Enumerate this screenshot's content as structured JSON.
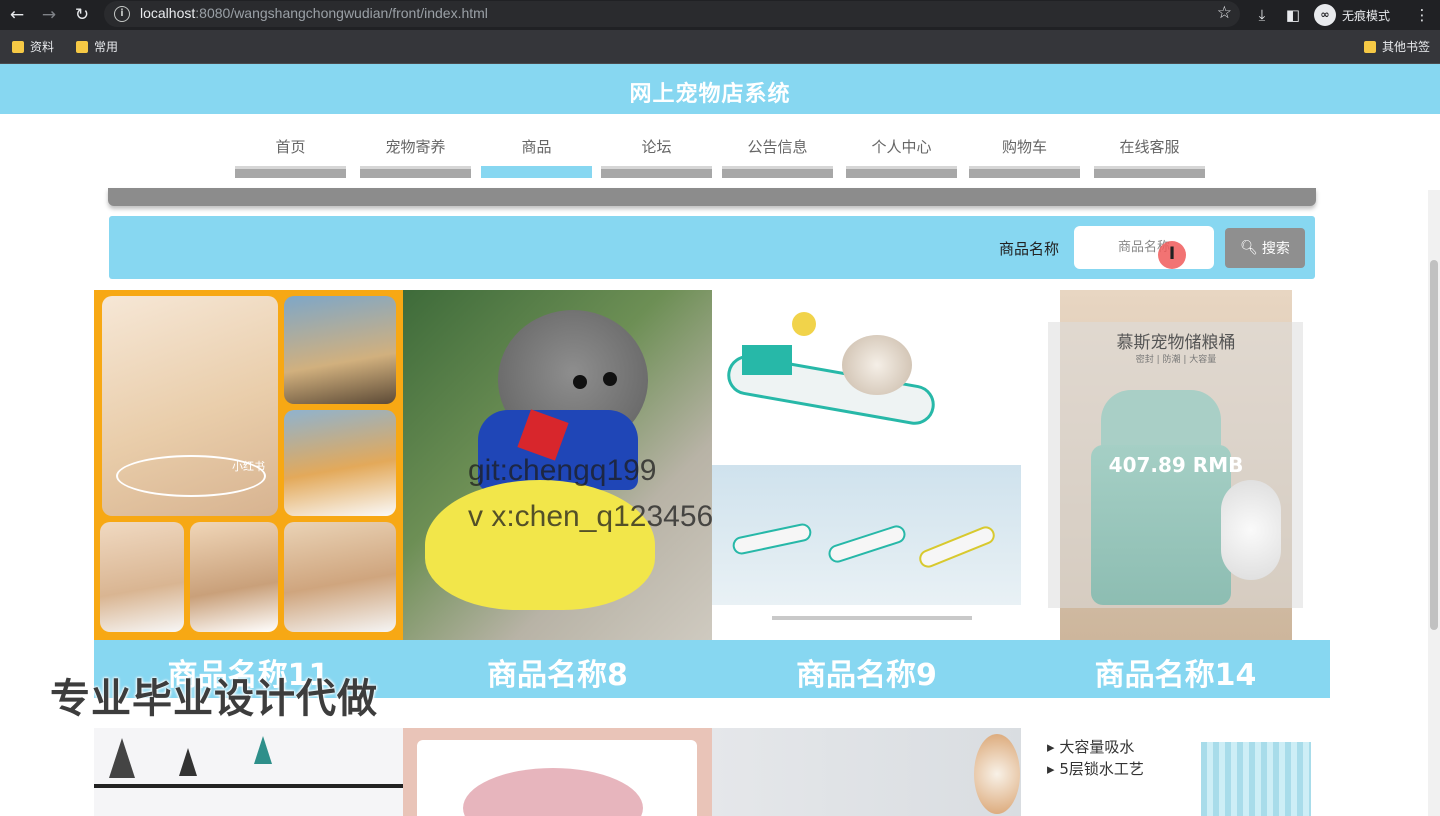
{
  "browser": {
    "url_host": "localhost",
    "url_rest": ":8080/wangshangchongwudian/front/index.html",
    "incognito_label": "无痕模式",
    "bookmarks": [
      "资料",
      "常用"
    ],
    "other_bookmarks": "其他书签"
  },
  "site": {
    "title": "网上宠物店系统"
  },
  "nav": {
    "items": [
      {
        "label": "首页"
      },
      {
        "label": "宠物寄养"
      },
      {
        "label": "商品"
      },
      {
        "label": "论坛"
      },
      {
        "label": "公告信息"
      },
      {
        "label": "个人中心"
      },
      {
        "label": "购物车"
      },
      {
        "label": "在线客服"
      }
    ],
    "active_index": 2
  },
  "search": {
    "label": "商品名称",
    "placeholder": "商品名称",
    "button_label": "搜索"
  },
  "products": [
    {
      "name": "商品名称11"
    },
    {
      "name": "商品名称8"
    },
    {
      "name": "商品名称9"
    },
    {
      "name": "商品名称14"
    }
  ],
  "product_images": {
    "bin_caption": "慕斯宠物储粮桶",
    "bin_price": "407.89 RMB",
    "bin_tags": "密封 | 防潮 | 大容量",
    "collage_tag": "小红书",
    "pad_line1": "大容量吸水",
    "pad_line2": "5层锁水工艺"
  },
  "overlay": {
    "contact_line1": "git:chengq199",
    "contact_line2": "v x:chen_q123456",
    "promo": "专业毕业设计代做"
  },
  "colors": {
    "accent": "#87d7f1",
    "nav_inactive": "#a7a7a7",
    "search_button": "#8f8f8f"
  }
}
